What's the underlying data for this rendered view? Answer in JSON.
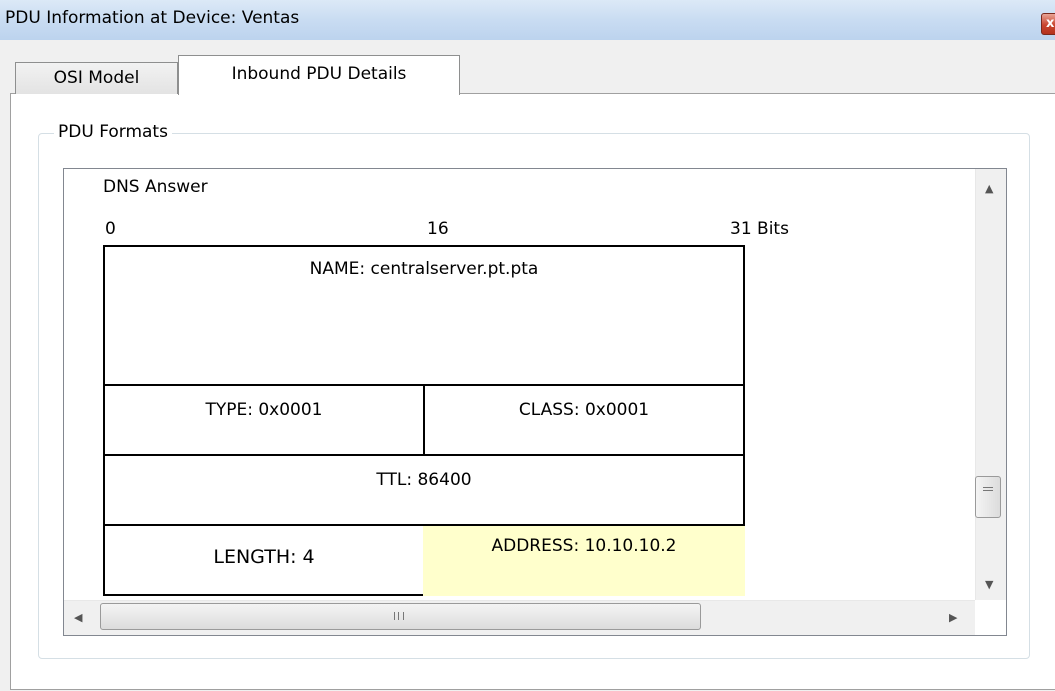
{
  "window": {
    "title": "PDU Information at Device: Ventas",
    "close_label": "x"
  },
  "tabs": [
    {
      "label": "OSI Model",
      "selected": false
    },
    {
      "label": "Inbound PDU Details",
      "selected": true
    }
  ],
  "group": {
    "title": "PDU Formats"
  },
  "pdu": {
    "heading": "DNS Answer",
    "bit_labels": {
      "start": "0",
      "mid": "16",
      "end": "31 Bits"
    },
    "fields": {
      "name": "NAME: centralserver.pt.pta",
      "type": "TYPE: 0x0001",
      "class": "CLASS: 0x0001",
      "ttl": "TTL: 86400",
      "length": "LENGTH: 4",
      "address": "ADDRESS: 10.10.10.2"
    },
    "highlight_color": "#ffffcc"
  },
  "scrollbars": {
    "up_arrow": "▲",
    "down_arrow": "▼",
    "left_arrow": "◀",
    "right_arrow": "▶"
  },
  "icons": {
    "close": "close-icon",
    "grip_vertical": "grip-lines-icon",
    "grip_horizontal": "grip-lines-icon"
  }
}
